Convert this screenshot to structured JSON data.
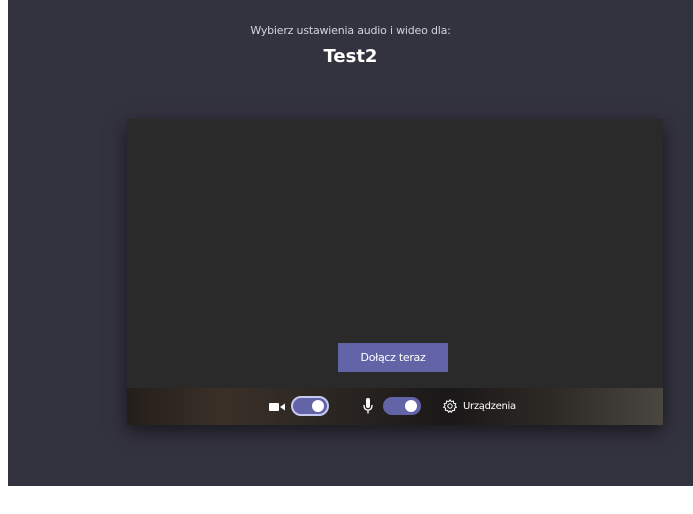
{
  "header": {
    "subtitle": "Wybierz ustawienia audio i wideo dla:",
    "meeting_name": "Test2"
  },
  "preview": {
    "join_button_label": "Dołącz teraz"
  },
  "controls": {
    "camera": {
      "icon": "camera-icon",
      "on": true
    },
    "microphone": {
      "icon": "microphone-icon",
      "on": true
    },
    "devices_label": "Urządzenia",
    "devices_icon": "gear-icon"
  },
  "colors": {
    "background": "#33323f",
    "accent": "#6264a7",
    "preview_bg": "#2a2a2a"
  }
}
